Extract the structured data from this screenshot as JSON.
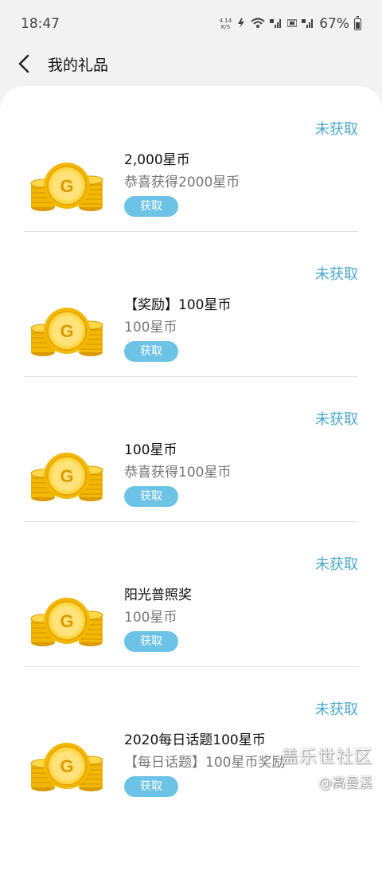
{
  "status_bar": {
    "time": "18:47",
    "speed_value": "4.14",
    "speed_unit": "K/S",
    "battery": "67%"
  },
  "header": {
    "title": "我的礼品",
    "back_icon": "back-arrow-icon"
  },
  "gifts": [
    {
      "status": "未获取",
      "title": "2,000星币",
      "description": "恭喜获得2000星币",
      "button": "获取",
      "icon": "coin-stack-icon"
    },
    {
      "status": "未获取",
      "title": "【奖励】100星币",
      "description": "100星币",
      "button": "获取",
      "icon": "coin-stack-icon"
    },
    {
      "status": "未获取",
      "title": "100星币",
      "description": "恭喜获得100星币",
      "button": "获取",
      "icon": "coin-stack-icon"
    },
    {
      "status": "未获取",
      "title": "阳光普照奖",
      "description": "100星币",
      "button": "获取",
      "icon": "coin-stack-icon"
    },
    {
      "status": "未获取",
      "title": "2020每日话题100星币",
      "description": "【每日话题】100星币奖励",
      "button": "获取",
      "icon": "coin-stack-icon"
    }
  ],
  "watermark": {
    "main": "盖乐世社区",
    "sub": "@高曼溪"
  },
  "colors": {
    "accent_status": "#4aa8c8",
    "button_bg": "#6cc3e6",
    "coin_gold": "#f5c518"
  }
}
